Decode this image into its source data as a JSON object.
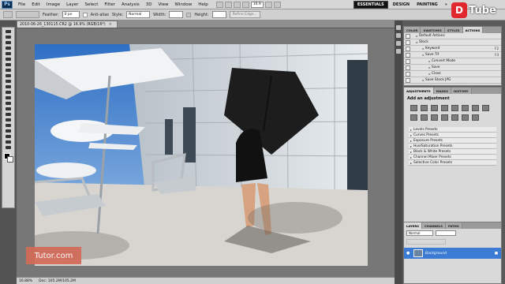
{
  "app": {
    "logo": "Ps"
  },
  "menu": [
    "File",
    "Edit",
    "Image",
    "Layer",
    "Select",
    "Filter",
    "Analysis",
    "3D",
    "View",
    "Window",
    "Help"
  ],
  "zoom_menu": "16.9",
  "workspaces": {
    "active": "ESSENTIALS",
    "others": [
      "DESIGN",
      "PAINTING"
    ]
  },
  "options": {
    "feather_label": "Feather:",
    "feather_value": "0 px",
    "antialias_label": "Anti-alias",
    "style_label": "Style:",
    "style_value": "Normal",
    "width_label": "Width:",
    "height_label": "Height:",
    "refine_edge": "Refine Edge..."
  },
  "document": {
    "tab_title": "2010-06-26_130115.CR2 @ 16.9% (RGB/16*)",
    "zoom_status": "16.88%",
    "doc_status": "Doc: 105.2M/105.2M"
  },
  "panels": {
    "actions_tabs": [
      "COLOR",
      "SWATCHES",
      "STYLES",
      "ACTIONS"
    ],
    "actions": [
      {
        "label": "Default Actions",
        "indent": 0,
        "shortcut": ""
      },
      {
        "label": "Stock",
        "indent": 0,
        "shortcut": ""
      },
      {
        "label": "Keyword",
        "indent": 1,
        "shortcut": "F2"
      },
      {
        "label": "Save Tif",
        "indent": 1,
        "shortcut": "F4"
      },
      {
        "label": "Convert Mode",
        "indent": 2,
        "shortcut": ""
      },
      {
        "label": "Save",
        "indent": 2,
        "shortcut": ""
      },
      {
        "label": "Close",
        "indent": 2,
        "shortcut": ""
      },
      {
        "label": "Save Stock JPG",
        "indent": 1,
        "shortcut": ""
      }
    ],
    "adjustment_tabs": [
      "ADJUSTMENTS",
      "MASKS",
      "HISTORY"
    ],
    "adjustment_title": "Add an adjustment",
    "presets": [
      "Levels Presets",
      "Curves Presets",
      "Exposure Presets",
      "Hue/Saturation Presets",
      "Black & White Presets",
      "Channel Mixer Presets",
      "Selective Color Presets"
    ],
    "layers_tabs": [
      "LAYERS",
      "CHANNELS",
      "PATHS"
    ],
    "layer_blend": "Normal",
    "layer_name": "Background"
  },
  "watermarks": {
    "tutor": "Tutor.com",
    "dtube": "Tube"
  },
  "colors": {
    "accent": "#3b7bd3",
    "ui_bg": "#535353"
  }
}
